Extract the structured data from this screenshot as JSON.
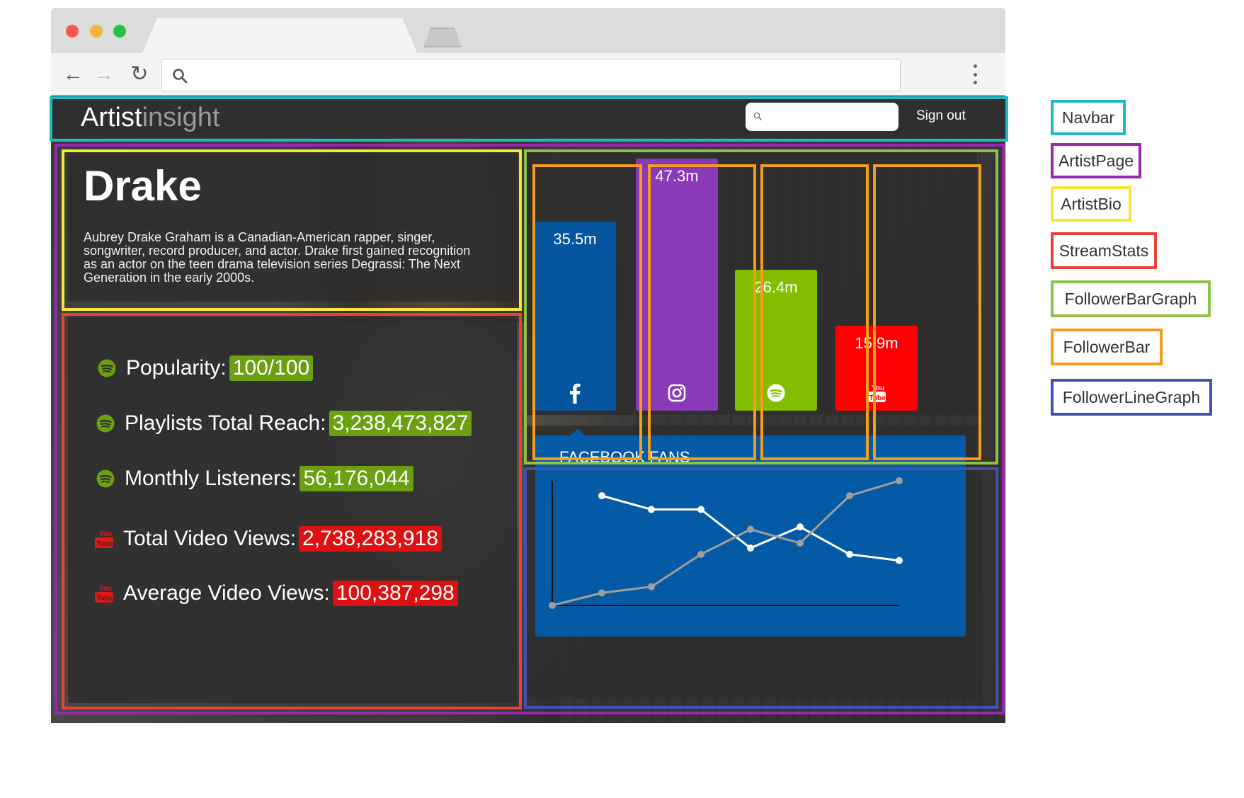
{
  "browser": {
    "url": ""
  },
  "navbar": {
    "brand_bold": "Artist",
    "brand_light": "insight",
    "search_placeholder": "",
    "signout_label": "Sign out"
  },
  "artist": {
    "name": "Drake",
    "bio": "Aubrey Drake Graham is a Canadian-American rapper, singer, songwriter, record producer, and actor. Drake first gained recognition as an actor on the teen drama television series Degrassi: The Next Generation in the early 2000s."
  },
  "stream_stats": [
    {
      "icon": "spotify-icon",
      "label": "Popularity:",
      "value": "100/100",
      "color": "#6aa012"
    },
    {
      "icon": "spotify-icon",
      "label": "Playlists Total Reach:",
      "value": "3,238,473,827",
      "color": "#6aa012"
    },
    {
      "icon": "spotify-icon",
      "label": "Monthly Listeners:",
      "value": "56,176,044",
      "color": "#6aa012"
    },
    {
      "icon": "youtube-icon",
      "label": "Total Video Views:",
      "value": "2,738,283,918",
      "color": "#dd1111"
    },
    {
      "icon": "youtube-icon",
      "label": "Average Video Views:",
      "value": "100,387,298",
      "color": "#dd1111"
    }
  ],
  "follower_bars": [
    {
      "platform_icon": "facebook-icon",
      "label": "35.5m",
      "value": 35.5,
      "color": "#05549e"
    },
    {
      "platform_icon": "instagram-icon",
      "label": "47.3m",
      "value": 47.3,
      "color": "#8a3ab9"
    },
    {
      "platform_icon": "spotify-icon",
      "label": "26.4m",
      "value": 26.4,
      "color": "#84bd00"
    },
    {
      "platform_icon": "youtube-icon",
      "label": "15.9m",
      "value": 15.9,
      "color": "#ff0000"
    }
  ],
  "follower_line_graph": {
    "title": "FACEBOOK FANS",
    "background": "#055aa5"
  },
  "chart_data": {
    "type": "line",
    "title": "FACEBOOK FANS",
    "x": [
      1,
      2,
      3,
      4,
      5,
      6,
      7,
      8
    ],
    "series": [
      {
        "values": [
          null,
          88,
          77,
          77,
          46,
          63,
          41,
          36
        ],
        "color": "#ffffff"
      },
      {
        "values": [
          0,
          10,
          15,
          41,
          61,
          50,
          88,
          100
        ],
        "color": "#9e9e9e"
      }
    ],
    "ylim": [
      0,
      100
    ],
    "grid": false
  },
  "annotations": [
    {
      "label": "Navbar",
      "color": "#1fb8c9"
    },
    {
      "label": "ArtistPage",
      "color": "#9b27b0"
    },
    {
      "label": "ArtistBio",
      "color": "#f3e83a"
    },
    {
      "label": "StreamStats",
      "color": "#e8403a"
    },
    {
      "label": "FollowerBarGraph",
      "color": "#8bc34a"
    },
    {
      "label": "FollowerBar",
      "color": "#f59c1a"
    },
    {
      "label": "FollowerLineGraph",
      "color": "#3f51b5"
    }
  ]
}
